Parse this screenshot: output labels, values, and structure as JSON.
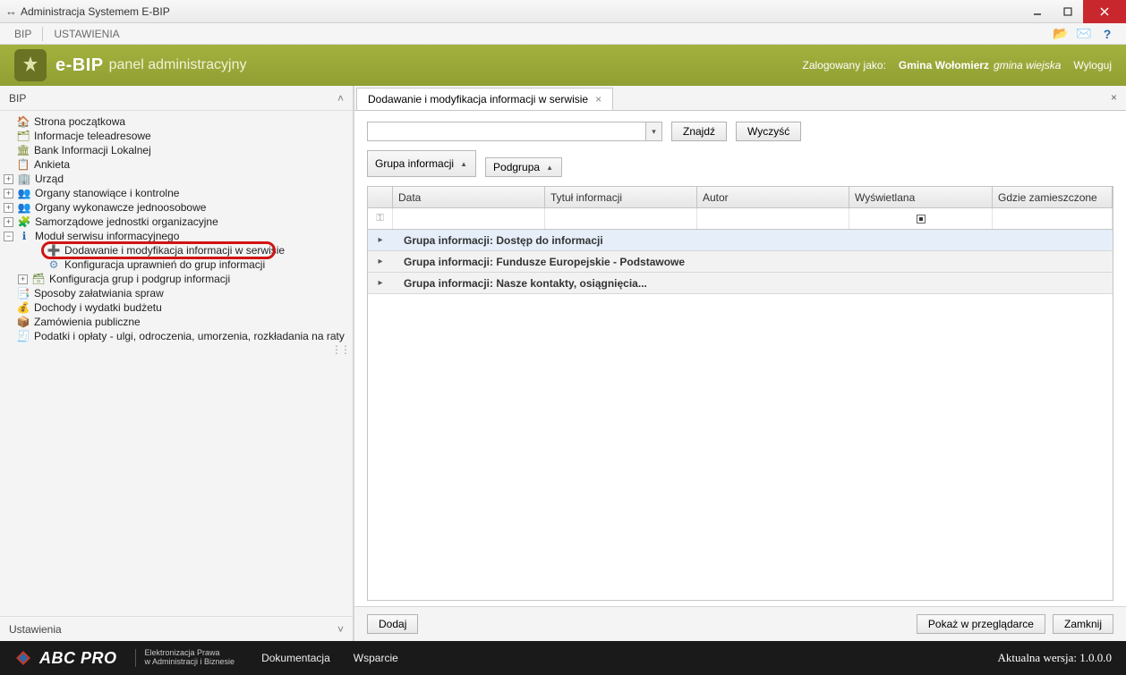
{
  "window": {
    "title": "Administracja Systemem E-BIP"
  },
  "menu": {
    "bip": "BIP",
    "ustawienia": "USTAWIENIA"
  },
  "header": {
    "brand": "e-BIP",
    "sub": "panel administracyjny",
    "logged_as_label": "Zalogowany jako:",
    "institution_name": "Gmina Wołomierz",
    "institution_type": "gmina wiejska",
    "logout": "Wyloguj"
  },
  "sidebar": {
    "section_bip": "BIP",
    "section_settings": "Ustawienia",
    "tree": [
      {
        "icon": "home-icon",
        "color": "#c0392b",
        "label": "Strona początkowa",
        "exp": null,
        "lvl": 0
      },
      {
        "icon": "card-icon",
        "color": "#7d8a2e",
        "label": "Informacje teleadresowe",
        "exp": null,
        "lvl": 0
      },
      {
        "icon": "bank-info-icon",
        "color": "#7d8a2e",
        "label": "Bank Informacji Lokalnej",
        "exp": null,
        "lvl": 0
      },
      {
        "icon": "survey-icon",
        "color": "#6b6b6b",
        "label": "Ankieta",
        "exp": null,
        "lvl": 0
      },
      {
        "icon": "office-icon",
        "color": "#2a6aa8",
        "label": "Urząd",
        "exp": "+",
        "lvl": 0
      },
      {
        "icon": "people-icon",
        "color": "#b04545",
        "label": "Organy stanowiące i kontrolne",
        "exp": "+",
        "lvl": 0
      },
      {
        "icon": "people-icon",
        "color": "#b07d45",
        "label": "Organy wykonawcze jednoosobowe",
        "exp": "+",
        "lvl": 0
      },
      {
        "icon": "org-icon",
        "color": "#6a8a3d",
        "label": "Samorządowe jednostki organizacyjne",
        "exp": "+",
        "lvl": 0
      },
      {
        "icon": "info-icon",
        "color": "#2a6aa8",
        "label": "Moduł serwisu informacyjnego",
        "exp": "−",
        "lvl": 0
      },
      {
        "icon": "add-icon",
        "color": "#2a6aa8",
        "label": "Dodawanie i modyfikacja informacji w serwisie",
        "exp": null,
        "lvl": 2,
        "highlight": true
      },
      {
        "icon": "gear-group-icon",
        "color": "#5a8ab8",
        "label": "Konfiguracja uprawnień do grup informacji",
        "exp": null,
        "lvl": 2
      },
      {
        "icon": "tree-config-icon",
        "color": "#6a8a3d",
        "label": "Konfiguracja grup i podgrup informacji",
        "exp": "+",
        "lvl": 1
      },
      {
        "icon": "cases-icon",
        "color": "#6b6b6b",
        "label": "Sposoby załatwiania spraw",
        "exp": null,
        "lvl": 0
      },
      {
        "icon": "budget-icon",
        "color": "#6b6b6b",
        "label": "Dochody i wydatki budżetu",
        "exp": null,
        "lvl": 0
      },
      {
        "icon": "public-orders-icon",
        "color": "#b07d45",
        "label": "Zamówienia publiczne",
        "exp": null,
        "lvl": 0
      },
      {
        "icon": "taxes-icon",
        "color": "#6b6b6b",
        "label": "Podatki i opłaty - ulgi, odroczenia, umorzenia, rozkładania na raty",
        "exp": null,
        "lvl": 0
      }
    ]
  },
  "tab": {
    "title": "Dodawanie i modyfikacja informacji w serwisie"
  },
  "search": {
    "find": "Znajdź",
    "clear": "Wyczyść"
  },
  "groupby": {
    "g1": "Grupa informacji",
    "g2": "Podgrupa"
  },
  "grid": {
    "cols": {
      "data": "Data",
      "tytul": "Tytuł informacji",
      "autor": "Autor",
      "wysw": "Wyświetlana",
      "gdzie": "Gdzie zamieszczone"
    },
    "rows": [
      {
        "label": "Grupa informacji: Dostęp do informacji",
        "active": true
      },
      {
        "label": "Grupa informacji: Fundusze Europejskie - Podstawowe",
        "active": false
      },
      {
        "label": "Grupa informacji: Nasze kontakty, osiągnięcia...",
        "active": false
      }
    ]
  },
  "actions": {
    "add": "Dodaj",
    "preview": "Pokaż w przeglądarce",
    "close": "Zamknij"
  },
  "footer": {
    "brand": "ABC PRO",
    "tag1": "Elektronizacja Prawa",
    "tag2": "w Administracji i Biznesie",
    "doc": "Dokumentacja",
    "support": "Wsparcie",
    "version_label": "Aktualna wersja:",
    "version": "1.0.0.0"
  }
}
